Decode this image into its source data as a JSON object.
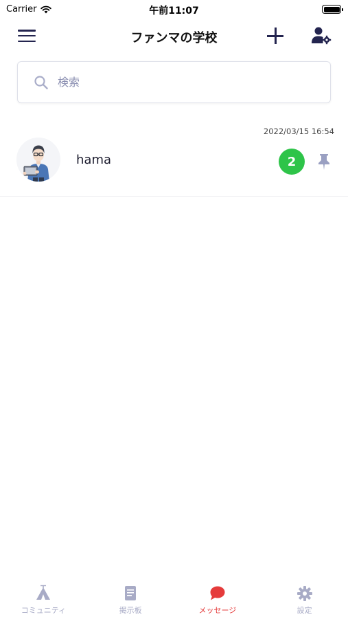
{
  "status_bar": {
    "carrier": "Carrier",
    "time": "午前11:07"
  },
  "nav": {
    "title": "ファンマの学校",
    "menu_icon": "hamburger-menu-icon",
    "add_icon": "plus-icon",
    "user_settings_icon": "user-gear-icon"
  },
  "search": {
    "placeholder": "検索"
  },
  "conversations": [
    {
      "name": "hama",
      "timestamp": "2022/03/15 16:54",
      "unread_count": "2",
      "pinned": true
    }
  ],
  "tabs": [
    {
      "label": "コミュニティ",
      "icon": "tent-icon",
      "active": false
    },
    {
      "label": "掲示板",
      "icon": "document-icon",
      "active": false
    },
    {
      "label": "メッセージ",
      "icon": "chat-bubble-icon",
      "active": true
    },
    {
      "label": "設定",
      "icon": "gear-icon",
      "active": false
    }
  ],
  "colors": {
    "nav_icon": "#23244f",
    "badge": "#2ec449",
    "tab_active": "#e53b3b",
    "tab_inactive": "#a8abc6",
    "placeholder": "#8c90b2"
  }
}
